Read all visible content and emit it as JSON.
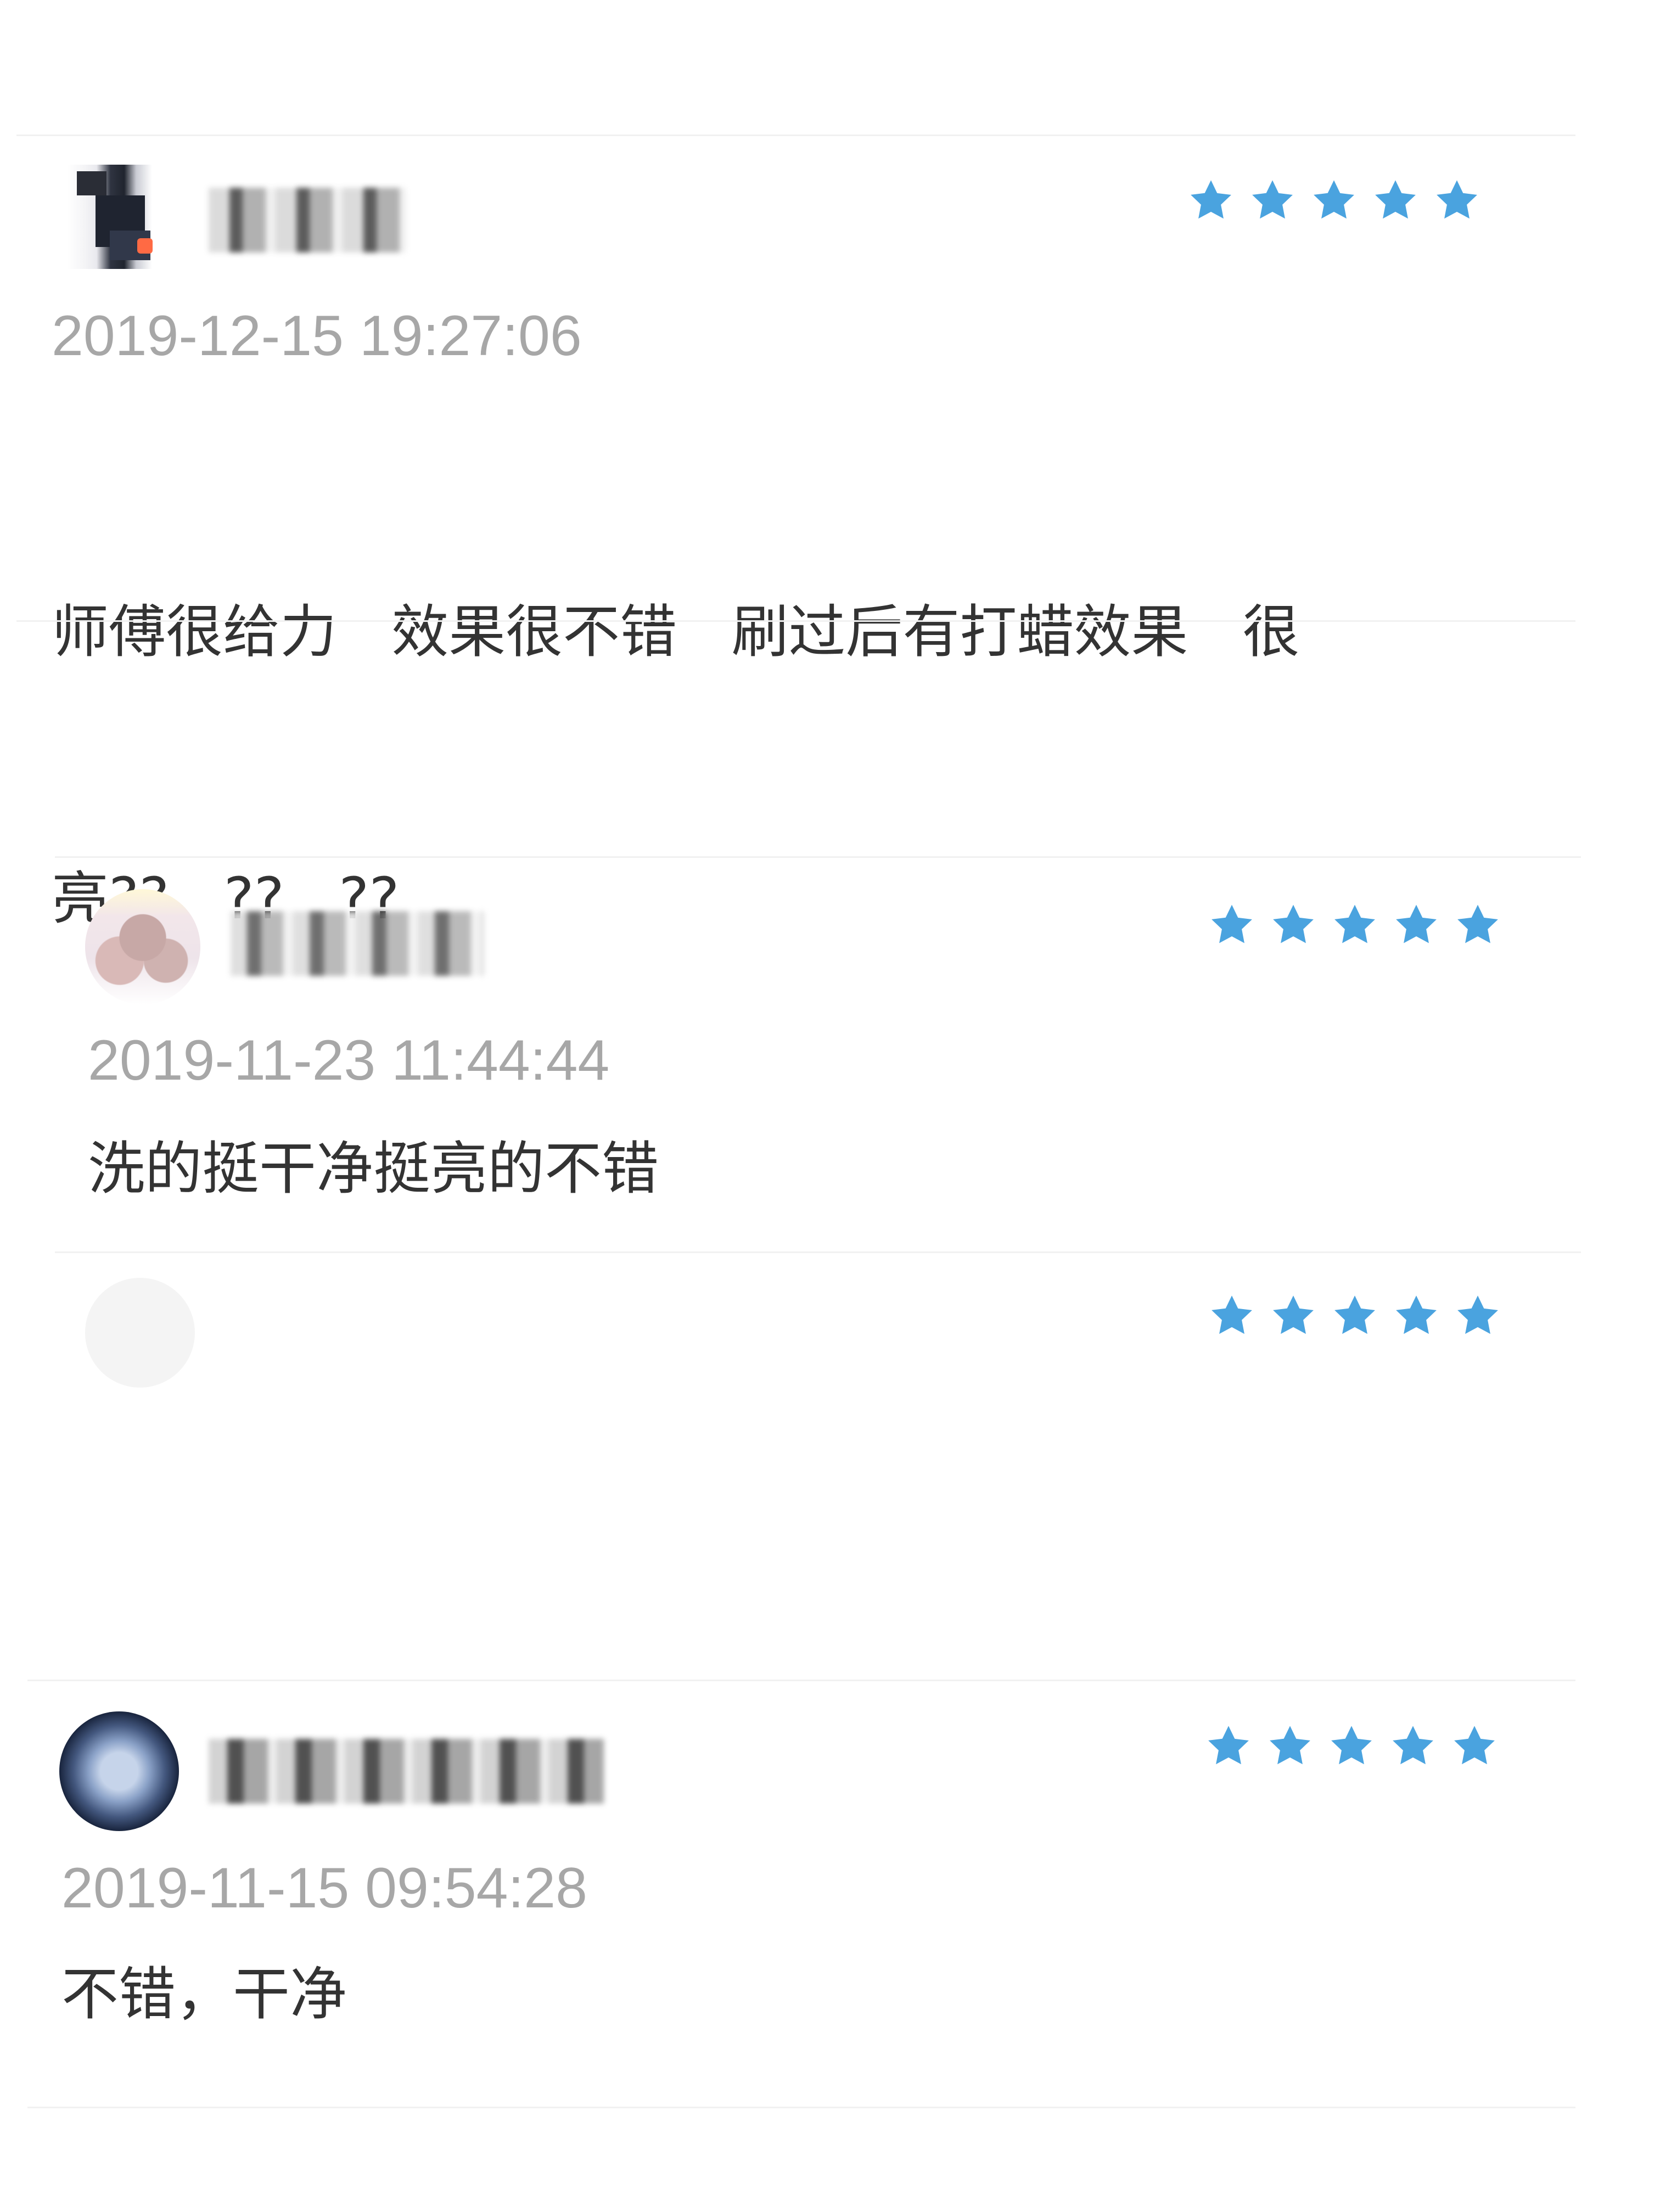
{
  "reviews": [
    {
      "user_name": "",
      "rating": 5,
      "date": "2019-12-15 19:27:06",
      "content": "师傅很给力  效果很不错  刷过后有打蜡效果  很亮??  ??  ??",
      "content_lines": [
        "师傅很给力   效果很不错   刷过后有打蜡效果   很",
        "亮??   ??   ??"
      ]
    },
    {
      "user_name": "",
      "rating": 5,
      "date": "2019-11-23 11:44:44",
      "content": "洗的挺干净挺亮的不错"
    },
    {
      "user_name": "",
      "rating": 5,
      "date": "",
      "content": ""
    },
    {
      "user_name": "",
      "rating": 5,
      "date": "2019-11-15 09:54:28",
      "content": "不错，干净"
    }
  ],
  "theme": {
    "star_color": "#4aa3df",
    "date_color": "#a7a7a7",
    "text_color": "#333333",
    "divider_color": "#f1f1f1"
  }
}
